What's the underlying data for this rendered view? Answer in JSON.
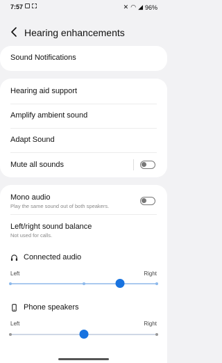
{
  "status_bar": {
    "time": "7:57",
    "battery": "96%"
  },
  "header": {
    "title": "Hearing enhancements"
  },
  "items": {
    "sound_notifications": "Sound Notifications",
    "hearing_aid_support": "Hearing aid support",
    "amplify_ambient_sound": "Amplify ambient sound",
    "adapt_sound": "Adapt Sound",
    "mute_all_sounds": "Mute all sounds",
    "mono_audio": "Mono audio",
    "mono_audio_sub": "Play the same sound out of both speakers.",
    "balance": "Left/right sound balance",
    "balance_sub": "Not used for calls."
  },
  "toggles": {
    "mute_all_sounds": false,
    "mono_audio": false
  },
  "connected_audio": {
    "label": "Connected audio",
    "left": "Left",
    "right": "Right",
    "value": 0.75
  },
  "phone_speakers": {
    "label": "Phone speakers",
    "left": "Left",
    "right": "Right",
    "value": 0.5
  },
  "colors": {
    "accent": "#1873e0"
  }
}
